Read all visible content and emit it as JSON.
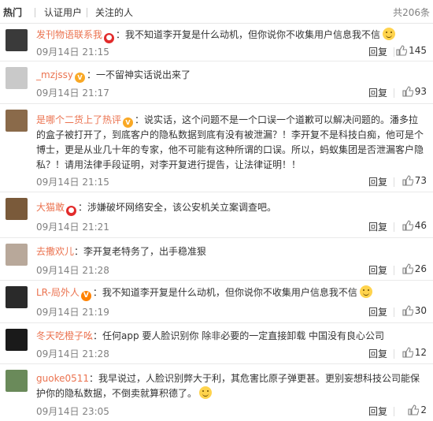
{
  "tabs": [
    {
      "label": "热门",
      "active": true
    },
    {
      "label": "认证用户",
      "active": false
    },
    {
      "label": "关注的人",
      "active": false
    }
  ],
  "total_count": "共206条",
  "reply_label": "回复",
  "comments": [
    {
      "username": "发刊物语联系我",
      "text": "：我不知道李开复是什么动机，但你说你不收集用户信息我不信",
      "time": "09月14日 21:15",
      "likes": "145",
      "badges": [
        "red-dot"
      ],
      "emoji": "doge-icon",
      "avatar_color": "#3a3a3a"
    },
    {
      "username": "_mzjssy",
      "text": "：一不留神实话说出来了",
      "time": "09月14日 21:17",
      "likes": "93",
      "badges": [
        "vip"
      ],
      "avatar_color": "#c9c9c9"
    },
    {
      "username": "是哪个二货上了热评",
      "line1": "：说实话，这个问题不是一个口误一个道歉可以解决问题的。潘多拉的盒子被打开了，到底客户的隐私数据到底有没有被泄漏？！李开复不是科技白痴，他可是个博士，更是从业几十年的专家，他不可能有这种所谓的口误。所以，蚂蚁集团是否泄漏客户隐私？！请用法律手段证明，对李开复进行提告，让法律证明！！",
      "time": "09月14日 21:15",
      "likes": "73",
      "badges": [
        "vip"
      ],
      "avatar_color": "#8a6a4a"
    },
    {
      "username": "大猫敢",
      "text": "：涉嫌破坏网络安全，该公安机关立案调查吧。",
      "time": "09月14日 21:21",
      "likes": "46",
      "badges": [
        "red-dot"
      ],
      "avatar_color": "#7a5a3a"
    },
    {
      "username": "去撒欢儿",
      "text": "：李开复老特务了，出手稳准狠",
      "time": "09月14日 21:28",
      "likes": "26",
      "badges": [],
      "avatar_color": "#b8a89a"
    },
    {
      "username": "LR-局外人",
      "text": "：我不知道李开复是什么动机，但你说你不收集用户信息我不信",
      "time": "09月14日 21:19",
      "likes": "30",
      "badges": [
        "crown"
      ],
      "emoji": "doge-icon",
      "avatar_color": "#2a2a2a"
    },
    {
      "username": "冬天吃橙子吆",
      "text": "：任何app 要人脸识别你 除非必要的一定直接卸载 中国没有良心公司",
      "time": "09月14日 21:28",
      "likes": "12",
      "badges": [],
      "avatar_color": "#1a1a1a"
    },
    {
      "username": "guoke0511",
      "line1": "：我早说过，人脸识别弊大于利，其危害比原子弹更甚。更别妄想科技公司能保护你的隐私数据，不倒卖就算积德了。",
      "time": "09月14日 23:05",
      "likes": "2",
      "badges": [],
      "emoji": "smile-icon",
      "avatar_color": "#6a8a5a"
    }
  ],
  "colors": {
    "username": "#eb7350",
    "meta": "#808080",
    "text": "#333333"
  }
}
